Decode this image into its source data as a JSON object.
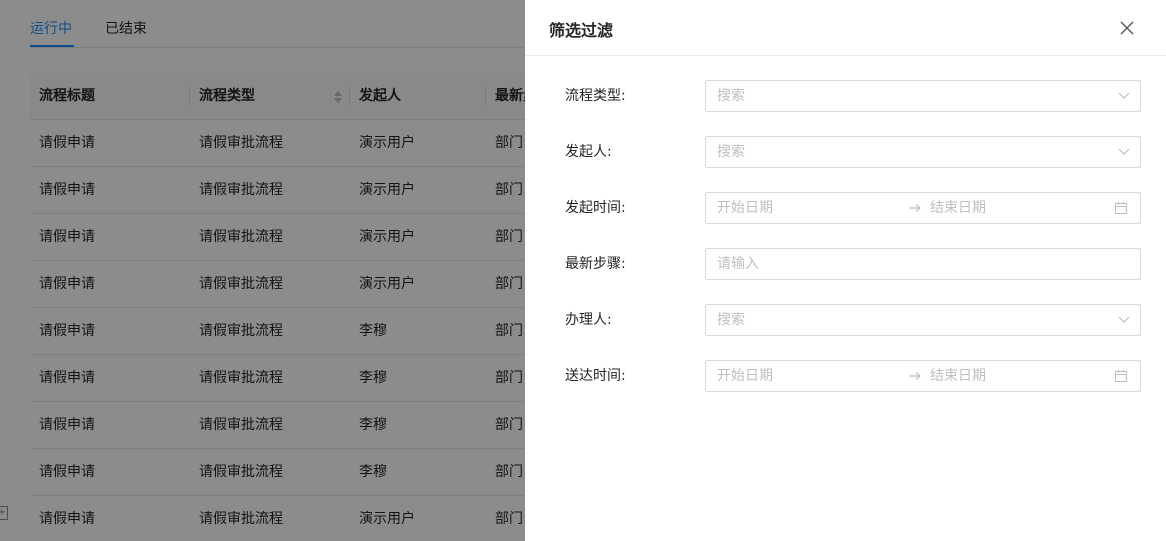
{
  "tabs": [
    {
      "label": "运行中",
      "active": true
    },
    {
      "label": "已结束",
      "active": false
    }
  ],
  "table": {
    "columns": [
      "流程标题",
      "流程类型",
      "发起人",
      "最新步"
    ],
    "rows": [
      [
        "请假申请",
        "请假审批流程",
        "演示用户",
        "部门"
      ],
      [
        "请假申请",
        "请假审批流程",
        "演示用户",
        "部门"
      ],
      [
        "请假申请",
        "请假审批流程",
        "演示用户",
        "部门"
      ],
      [
        "请假申请",
        "请假审批流程",
        "演示用户",
        "部门"
      ],
      [
        "请假申请",
        "请假审批流程",
        "李穆",
        "部门"
      ],
      [
        "请假申请",
        "请假审批流程",
        "李穆",
        "部门"
      ],
      [
        "请假申请",
        "请假审批流程",
        "李穆",
        "部门"
      ],
      [
        "请假申请",
        "请假审批流程",
        "李穆",
        "部门"
      ],
      [
        "请假申请",
        "请假审批流程",
        "演示用户",
        "部门"
      ]
    ]
  },
  "drawer": {
    "title": "筛选过滤",
    "fields": {
      "process_type": {
        "label": "流程类型:",
        "placeholder": "搜索"
      },
      "initiator": {
        "label": "发起人:",
        "placeholder": "搜索"
      },
      "initiate_time": {
        "label": "发起时间:",
        "start_placeholder": "开始日期",
        "end_placeholder": "结束日期"
      },
      "latest_step": {
        "label": "最新步骤:",
        "placeholder": "请输入"
      },
      "handler": {
        "label": "办理人:",
        "placeholder": "搜索"
      },
      "delivery_time": {
        "label": "送达时间:",
        "start_placeholder": "开始日期",
        "end_placeholder": "结束日期"
      }
    }
  },
  "colors": {
    "accent": "#1890ff",
    "border": "#d9d9d9",
    "placeholder": "#bfbfbf"
  },
  "icons": [
    "close-icon",
    "chevron-down-icon",
    "arrow-right-icon",
    "calendar-icon",
    "sort-icon"
  ]
}
